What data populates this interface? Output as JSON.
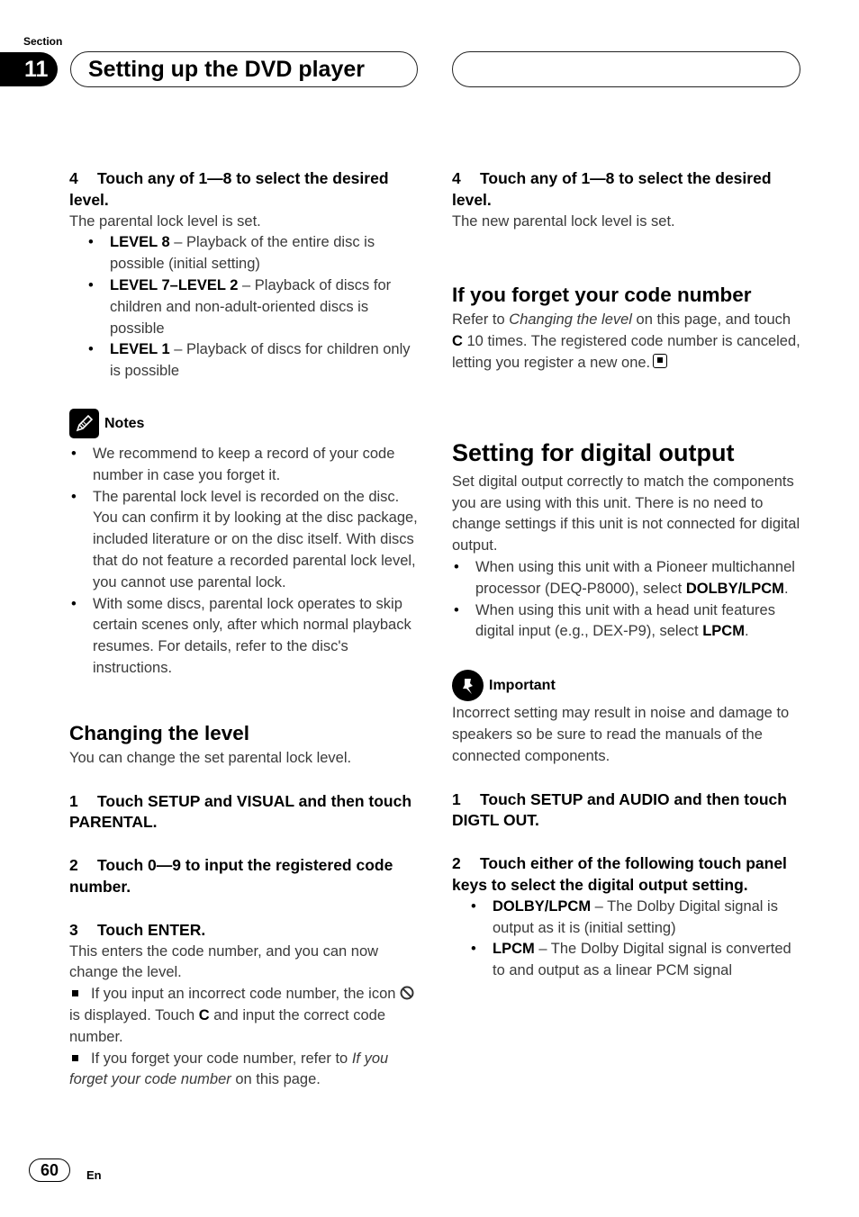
{
  "header": {
    "section_label": "Section",
    "section_number": "11",
    "title": "Setting up the DVD player"
  },
  "left": {
    "step4": {
      "num": "4",
      "text": "Touch any of 1—8 to select the desired level."
    },
    "step4_result": "The parental lock level is set.",
    "levels": [
      {
        "key": "LEVEL 8",
        "desc": " – Playback of the entire disc is possible (initial setting)"
      },
      {
        "key": "LEVEL 7–LEVEL 2",
        "desc": " – Playback of discs for children and non-adult-oriented discs is possible"
      },
      {
        "key": "LEVEL 1",
        "desc": " – Playback of discs for children only is possible"
      }
    ],
    "notes": {
      "label": "Notes",
      "icon": "pencil-icon",
      "items": [
        "We recommend to keep a record of your code number in case you forget it.",
        "The parental lock level is recorded on the disc. You can confirm it by looking at the disc package, included literature or on the disc itself. With discs that do not feature a recorded parental lock level, you cannot use parental lock.",
        "With some discs, parental lock operates to skip certain scenes only, after which normal playback resumes. For details, refer to the disc's instructions."
      ]
    },
    "changing": {
      "heading": "Changing the level",
      "intro": "You can change the set parental lock level.",
      "step1": {
        "num": "1",
        "text": "Touch SETUP and VISUAL and then touch PARENTAL."
      },
      "step2": {
        "num": "2",
        "text": "Touch 0—9 to input the registered code number."
      },
      "step3": {
        "num": "3",
        "text": "Touch ENTER."
      },
      "step3_result": "This enters the code number, and you can now change the level.",
      "tip1_a": "If you input an incorrect code number, the icon ",
      "tip1_icon": "prohibited-icon",
      "tip1_b": " is displayed. Touch ",
      "tip1_key": "C",
      "tip1_c": " and input the correct code number.",
      "tip2_a": "If you forget your code number, refer to ",
      "tip2_ref": "If you forget your code number",
      "tip2_b": " on this page."
    }
  },
  "right": {
    "step4": {
      "num": "4",
      "text": "Touch any of 1—8 to select the desired level."
    },
    "step4_result": "The new parental lock level is set.",
    "forget": {
      "heading": "If you forget your code number",
      "text_a": "Refer to ",
      "text_ref": "Changing the level",
      "text_b": " on this page, and touch ",
      "text_key": "C",
      "text_c": " 10 times. The registered code number is canceled, letting you register a new one."
    },
    "digital": {
      "heading": "Setting for digital output",
      "intro": "Set digital output correctly to match the components you are using with this unit. There is no need to change settings if this unit is not connected for digital output.",
      "bullets": [
        {
          "text": "When using this unit with a Pioneer multichannel processor (DEQ-P8000), select ",
          "key": "DOLBY/LPCM",
          "end": "."
        },
        {
          "text": "When using this unit with a head unit features digital input (e.g., DEX-P9), select ",
          "key": "LPCM",
          "end": "."
        }
      ],
      "important": {
        "label": "Important",
        "icon": "pushpin-icon",
        "text": "Incorrect setting may result in noise and damage to speakers so be sure to read the manuals of the connected components."
      },
      "step1": {
        "num": "1",
        "text": "Touch SETUP and AUDIO and then touch DIGTL OUT."
      },
      "step2": {
        "num": "2",
        "text": "Touch either of the following touch panel keys to select the digital output setting."
      },
      "options": [
        {
          "key": "DOLBY/LPCM",
          "desc": " – The Dolby Digital signal is output as it is (initial setting)"
        },
        {
          "key": "LPCM",
          "desc": " – The Dolby Digital signal is converted to and output as a linear PCM signal"
        }
      ]
    }
  },
  "footer": {
    "page_number": "60",
    "language": "En"
  }
}
